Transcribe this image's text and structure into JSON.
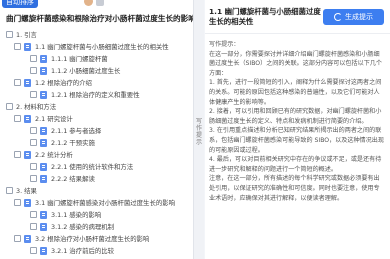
{
  "left": {
    "auto_button": "自动排序",
    "doc_title": "曲门螺旋杆菌感染和根除治疗对小肠杆菌过度生长的影响",
    "outline": [
      {
        "level": 0,
        "label": "1. 引言"
      },
      {
        "level": 1,
        "label": "1.1 幽门螺旋杆菌与小肠细菌过度生长的相关性"
      },
      {
        "level": 2,
        "label": "1.1.1 幽门螺旋杆菌"
      },
      {
        "level": 2,
        "label": "1.1.2 小肠细菌过度生长"
      },
      {
        "level": 1,
        "label": "1.2 根除治疗的介绍"
      },
      {
        "level": 2,
        "label": "1.2.1 根除治疗的定义和重要性"
      },
      {
        "level": 0,
        "label": "2. 材料和方法"
      },
      {
        "level": 1,
        "label": "2.1 研究设计"
      },
      {
        "level": 2,
        "label": "2.1.1 参与者选择"
      },
      {
        "level": 2,
        "label": "2.1.2 干预实施"
      },
      {
        "level": 1,
        "label": "2.2 统计分析"
      },
      {
        "level": 2,
        "label": "2.2.1 使用的统计软件和方法"
      },
      {
        "level": 2,
        "label": "2.2.2 结果解读"
      },
      {
        "level": 0,
        "label": "3. 结果"
      },
      {
        "level": 1,
        "label": "3.1 幽门螺旋杆菌感染对小肠杆菌过度生长的影响"
      },
      {
        "level": 2,
        "label": "3.1.1 感染的影响"
      },
      {
        "level": 2,
        "label": "3.1.2 感染的病理机制"
      },
      {
        "level": 1,
        "label": "3.2 根除治疗对小肠杆菌过度生长的影响"
      },
      {
        "level": 2,
        "label": "3.2.1 治疗前后的比较"
      }
    ]
  },
  "mid": {
    "tab_label": "写作提示"
  },
  "right": {
    "title": "1.1 幽门螺旋杆菌与小肠细菌过度生长的相关性",
    "generate_button": "生成提示",
    "prompt_lines": [
      "写作提示：",
      "在这一部分，你需要探讨并详细介绍幽门螺旋杆菌感染和小肠细菌过度生长（SIBO）之间的关联。这部分内容可以包括以下几个方面：",
      "1. 首先，进行一段简短的引入，阐释为什么需要探讨这两者之间的关系。可能的原因包括这种感染的普遍性，以及它们可能对人体健康产生的影响等。",
      "2. 接着，可以引用和回顾已有的研究数据，对幽门螺旋杆菌和小肠细菌过度生长的定义、特点和发病机制进行简要的介绍。",
      "3. 在引用重点描述和分析已知研究结果所揭示出的两者之间的联系，包括幽门螺旋杆菌感染可能导致的 SIBO，以及这种情况出现的可能原因或过程。",
      "4. 最后，可以对目前相关研究中存在的争议或不足，或是还有待进一步研究和解释的问题进行一个简短的概述。",
      "注意，在这一部分，所有描述的每个科学研究或数据必须要有出处引用，以保证研究的准确性和可信度。同时也要注意，使用专业术语时，应确保对其进行解释，以便读者理解。"
    ]
  }
}
